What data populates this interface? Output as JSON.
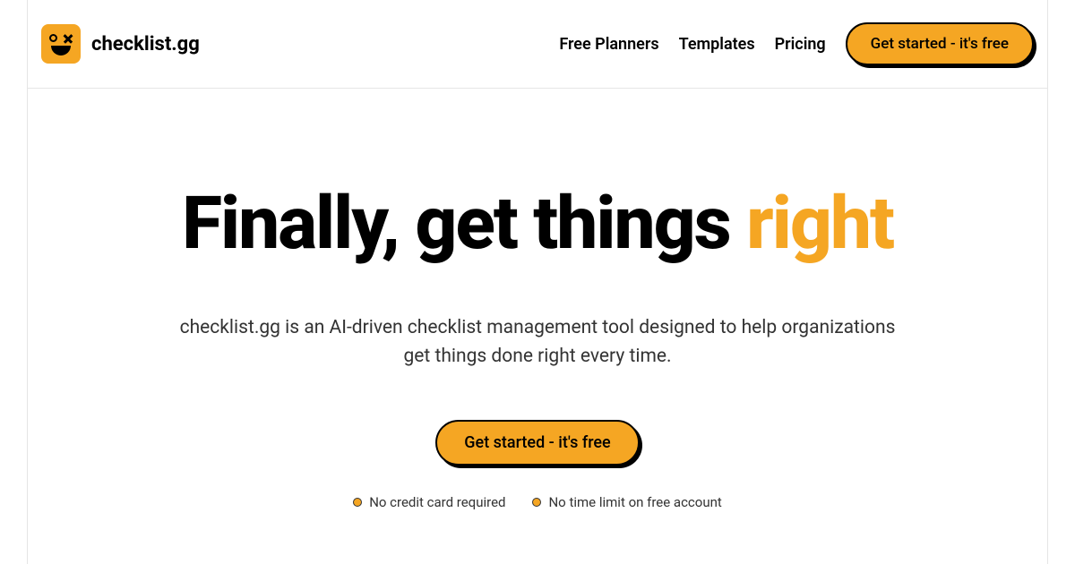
{
  "brand": {
    "name": "checklist.gg"
  },
  "nav": {
    "links": [
      "Free Planners",
      "Templates",
      "Pricing"
    ],
    "cta": "Get started - it's free"
  },
  "hero": {
    "title_main": "Finally, get things ",
    "title_accent": "right",
    "subtitle_line1": "checklist.gg is an AI-driven checklist management tool designed to help organizations",
    "subtitle_line2": "get things done right every time.",
    "cta": "Get started - it's free"
  },
  "benefits": {
    "items": [
      "No credit card required",
      "No time limit on free account"
    ]
  },
  "colors": {
    "accent": "#f5a623"
  }
}
